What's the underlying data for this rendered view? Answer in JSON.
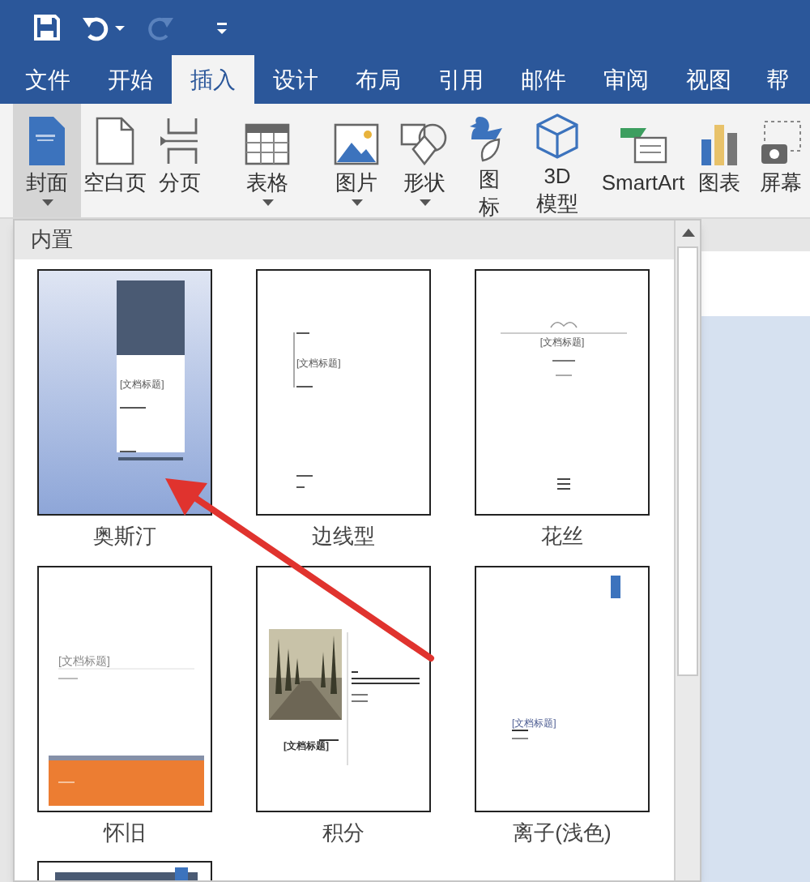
{
  "quick_access": [
    {
      "kind": "save",
      "disabled": false
    },
    {
      "kind": "undo",
      "disabled": false
    },
    {
      "kind": "caret",
      "disabled": false
    },
    {
      "kind": "redo",
      "disabled": true
    },
    {
      "kind": "customize",
      "disabled": false
    }
  ],
  "tabs": [
    {
      "label": "文件",
      "selected": false
    },
    {
      "label": "开始",
      "selected": false
    },
    {
      "label": "插入",
      "selected": true
    },
    {
      "label": "设计",
      "selected": false
    },
    {
      "label": "布局",
      "selected": false
    },
    {
      "label": "引用",
      "selected": false
    },
    {
      "label": "邮件",
      "selected": false
    },
    {
      "label": "审阅",
      "selected": false
    },
    {
      "label": "视图",
      "selected": false
    },
    {
      "label": "帮",
      "selected": false
    }
  ],
  "ribbon": [
    {
      "kind": "cover",
      "label": "封面",
      "caret": true,
      "selected": true
    },
    {
      "kind": "blank",
      "label": "空白页",
      "caret": false,
      "selected": false
    },
    {
      "kind": "break",
      "label": "分页",
      "caret": false,
      "selected": false
    },
    {
      "kind": "separator"
    },
    {
      "kind": "table",
      "label": "表格",
      "caret": true,
      "selected": false
    },
    {
      "kind": "separator"
    },
    {
      "kind": "picture",
      "label": "图片",
      "caret": true,
      "selected": false
    },
    {
      "kind": "shapes",
      "label": "形状",
      "caret": true,
      "selected": false
    },
    {
      "kind": "icons",
      "label": "图标",
      "caret": false,
      "selected": false
    },
    {
      "kind": "model",
      "label": "3D\n模型",
      "caret": false,
      "selected": false
    },
    {
      "kind": "smartart",
      "label": "SmartArt",
      "caret": false,
      "selected": false
    },
    {
      "kind": "chart",
      "label": "图表",
      "caret": false,
      "selected": false
    },
    {
      "kind": "screenshot",
      "label": "屏幕",
      "caret": false,
      "selected": false
    }
  ],
  "gallery": {
    "header": "内置",
    "items": [
      {
        "kind": "austin",
        "label": "奥斯汀",
        "title": "[文档标题]"
      },
      {
        "kind": "sideline",
        "label": "边线型",
        "title": "[文档标题]"
      },
      {
        "kind": "filigree",
        "label": "花丝",
        "title": "[文档标题]"
      },
      {
        "kind": "retro",
        "label": "怀旧",
        "title": "[文档标题]"
      },
      {
        "kind": "integral",
        "label": "积分",
        "title": "[文档标题]"
      },
      {
        "kind": "ion",
        "label": "离子(浅色)",
        "title": "[文档标题]"
      },
      {
        "kind": "band"
      }
    ]
  }
}
